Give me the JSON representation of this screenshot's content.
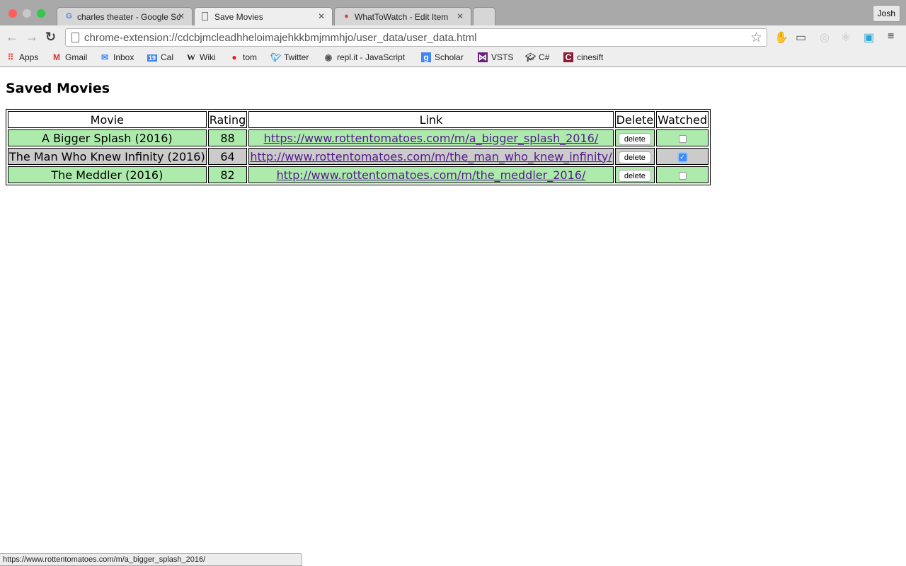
{
  "browser": {
    "tabs": [
      {
        "title": "charles theater - Google Sc",
        "icon": "google-icon"
      },
      {
        "title": "Save Movies",
        "icon": "page-icon",
        "active": true
      },
      {
        "title": "WhatToWatch - Edit Item",
        "icon": "chrome-icon"
      }
    ],
    "profile": "Josh",
    "url": "chrome-extension://cdcbjmcleadhheloimajehkkbmjmmhjo/user_data/user_data.html",
    "bookmarks": [
      "Apps",
      "Gmail",
      "Inbox",
      "Cal",
      "Wiki",
      "tom",
      "Twitter",
      "repl.it - JavaScript",
      "Scholar",
      "VSTS",
      "C#",
      "cinesift"
    ],
    "cal_icon_text": "19"
  },
  "page": {
    "title": "Saved Movies",
    "headers": [
      "Movie",
      "Rating",
      "Link",
      "Delete",
      "Watched"
    ],
    "delete_label": "delete",
    "rows": [
      {
        "movie": "A Bigger Splash (2016)",
        "rating": "88",
        "link": "https://www.rottentomatoes.com/m/a_bigger_splash_2016/",
        "watched": false
      },
      {
        "movie": "The Man Who Knew Infinity (2016)",
        "rating": "64",
        "link": "http://www.rottentomatoes.com/m/the_man_who_knew_infinity/",
        "watched": true
      },
      {
        "movie": "The Meddler (2016)",
        "rating": "82",
        "link": "http://www.rottentomatoes.com/m/the_meddler_2016/",
        "watched": false
      }
    ],
    "colors": {
      "unwatched_row": "#acebac",
      "watched_row": "#cbcbcb",
      "link": "#551a8b"
    }
  },
  "status_bar": "https://www.rottentomatoes.com/m/a_bigger_splash_2016/"
}
